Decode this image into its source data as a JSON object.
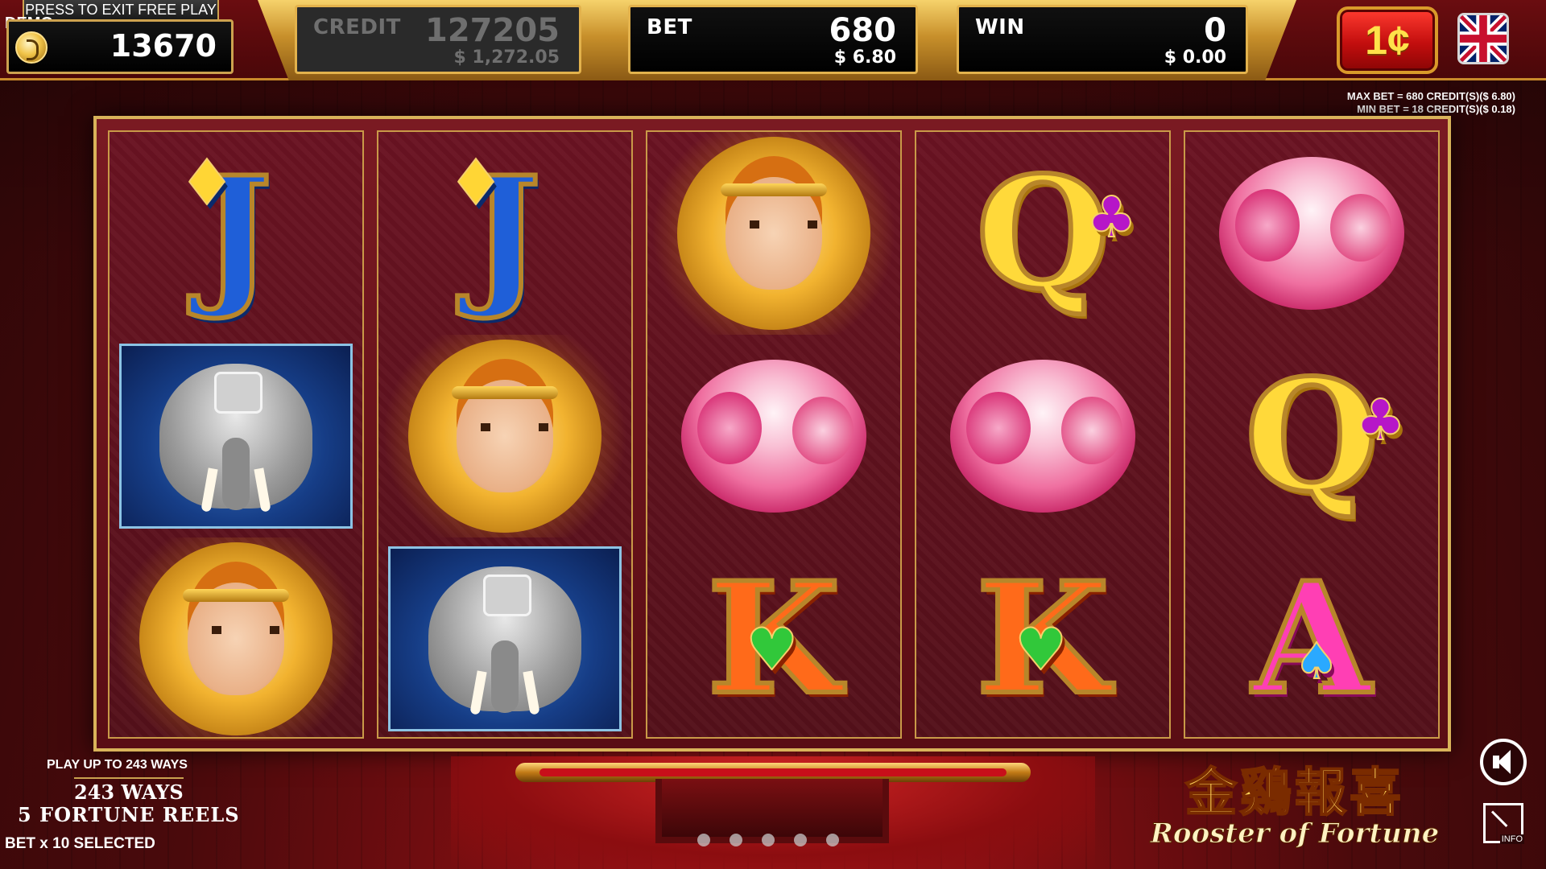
{
  "header": {
    "demo_label": "DEMO",
    "exit_free_play_label": "PRESS TO EXIT FREE PLAY",
    "balance": "13670",
    "credit": {
      "label": "CREDIT",
      "value": "127205",
      "currency": "$ 1,272.05"
    },
    "bet": {
      "label": "BET",
      "value": "680",
      "currency": "$ 6.80"
    },
    "win": {
      "label": "WIN",
      "value": "0",
      "currency": "$ 0.00"
    },
    "denomination": "1¢"
  },
  "bet_limits": {
    "max": "MAX BET = 680 CREDIT(S)($ 6.80)",
    "min": "MIN BET = 18 CREDIT(S)($ 0.18)"
  },
  "reels": [
    [
      "J",
      "elephant",
      "monkey-king"
    ],
    [
      "J",
      "monkey-king",
      "elephant"
    ],
    [
      "monkey-king",
      "peony",
      "K"
    ],
    [
      "Q",
      "peony",
      "K"
    ],
    [
      "peony",
      "Q",
      "A"
    ]
  ],
  "ways_panel": {
    "play_up_to": "PLAY UP TO 243 WAYS",
    "ways": "243 WAYS",
    "fortune_reels": "5 FORTUNE REELS",
    "bet_selected": "BET x 10 SELECTED"
  },
  "logo": {
    "chinese": "金鷄報喜",
    "english": "Rooster of Fortune"
  },
  "info_label": "INFO",
  "page_dots": 5,
  "colors": {
    "gold": "#d9b35a",
    "frame_red": "#6a1322",
    "denom_red": "#c30e0e",
    "denom_text": "#ffe14a"
  }
}
